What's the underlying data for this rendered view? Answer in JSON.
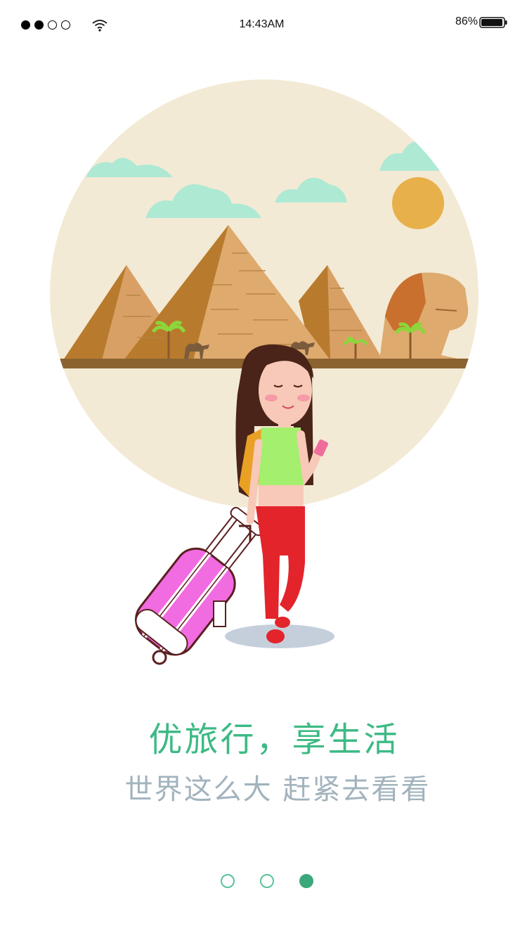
{
  "status_bar": {
    "time": "14:43AM",
    "battery_percent": "86%",
    "battery_level": 0.86,
    "signal_bars_filled": 2,
    "signal_bars_total": 4,
    "icons": [
      "signal-dots-icon",
      "wifi-icon",
      "battery-icon"
    ]
  },
  "illustration": {
    "name": "traveler-girl-with-pyramids-illustration",
    "colors": {
      "backdrop": "#f3ead5",
      "cloud": "#aee9d4",
      "sun": "#e8b04a",
      "shirt": "#a4ef6e",
      "pants": "#e3242b",
      "suitcase": "#f06ce0"
    }
  },
  "onboarding": {
    "title": "优旅行，享生活",
    "subtitle": "世界这么大 赶紧去看看"
  },
  "pager": {
    "pages": 3,
    "active_index": 2
  },
  "colors": {
    "accent": "#3dba84",
    "subtitle": "#a2b3bd"
  }
}
